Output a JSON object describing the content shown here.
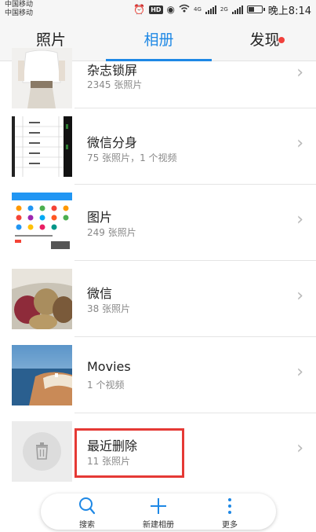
{
  "status_bar": {
    "carrier_1": "中国移动",
    "carrier_2": "中国移动",
    "hd_badge": "HD",
    "net_1": "4G",
    "net_2": "2G",
    "time": "晚上8:14",
    "battery_level": 0.45
  },
  "tabs": [
    {
      "label": "照片"
    },
    {
      "label": "相册"
    },
    {
      "label": "发现"
    }
  ],
  "active_tab": "相册",
  "albums": [
    {
      "title": "杂志锁屏",
      "count": "2345 张照片"
    },
    {
      "title": "微信分身",
      "count": "75 张照片，1 个视频"
    },
    {
      "title": "图片",
      "count": "249 张照片"
    },
    {
      "title": "微信",
      "count": "38 张照片"
    },
    {
      "title": "Movies",
      "count": "1 个视频"
    },
    {
      "title": "最近删除",
      "count": "11 张照片"
    }
  ],
  "bottom_bar": {
    "search_label": "搜索",
    "new_album_label": "新建相册",
    "more_label": "更多"
  },
  "colors": {
    "accent": "#1e88e5",
    "badge": "#f1403c",
    "highlight": "#e53935"
  }
}
